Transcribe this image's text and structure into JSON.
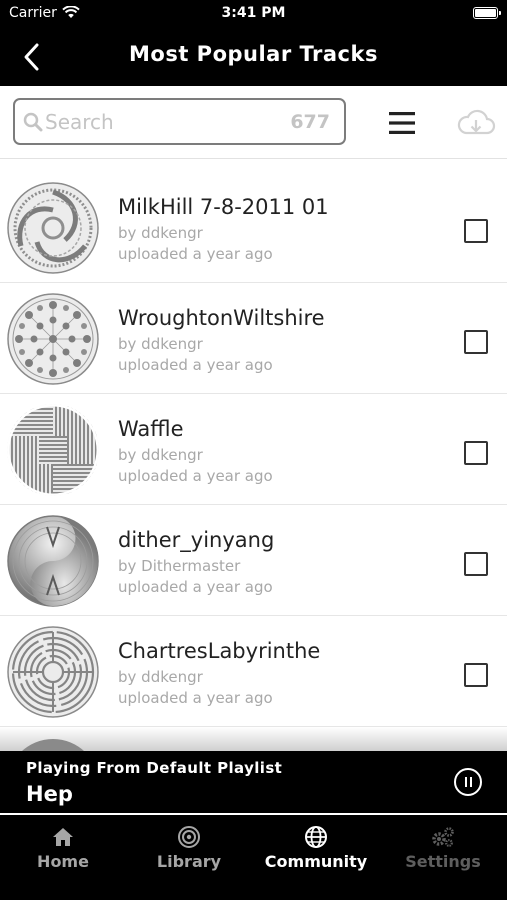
{
  "status_bar": {
    "carrier": "Carrier",
    "time": "3:41 PM"
  },
  "nav": {
    "title": "Most Popular Tracks",
    "back_icon": "chevron-left-icon"
  },
  "toolbar": {
    "search_placeholder": "Search",
    "search_value": "",
    "track_count": "677",
    "menu_icon": "hamburger-menu-icon",
    "download_icon": "cloud-download-icon"
  },
  "tracks": [
    {
      "title": "MilkHill 7-8-2011 01",
      "author": "by ddkengr",
      "uploaded": "uploaded a year ago",
      "checked": false,
      "pattern": "triskelion"
    },
    {
      "title": "WroughtonWiltshire",
      "author": "by ddkengr",
      "uploaded": "uploaded a year ago",
      "checked": false,
      "pattern": "dot-mandala"
    },
    {
      "title": "Waffle",
      "author": "by ddkengr",
      "uploaded": "uploaded a year ago",
      "checked": false,
      "pattern": "maze-lines"
    },
    {
      "title": "dither_yinyang",
      "author": "by Dithermaster",
      "uploaded": "uploaded a year ago",
      "checked": false,
      "pattern": "yinyang"
    },
    {
      "title": "ChartresLabyrinthe",
      "author": "by ddkengr",
      "uploaded": "uploaded a year ago",
      "checked": false,
      "pattern": "labyrinth"
    }
  ],
  "now_playing": {
    "label": "Playing From Default Playlist",
    "track": "Hep",
    "pause_icon": "pause-circle-icon"
  },
  "tabs": [
    {
      "label": "Home",
      "icon": "home-icon",
      "state": "inactive"
    },
    {
      "label": "Library",
      "icon": "target-icon",
      "state": "inactive"
    },
    {
      "label": "Community",
      "icon": "globe-icon",
      "state": "active"
    },
    {
      "label": "Settings",
      "icon": "gears-icon",
      "state": "disabled"
    }
  ],
  "colors": {
    "bar_background": "#000000",
    "tab_active": "#ffffff",
    "tab_inactive": "#a6a6a6",
    "tab_disabled": "#5e5e5e",
    "placeholder": "#c4c4c4",
    "subtitle_text": "#a8a8a8"
  }
}
